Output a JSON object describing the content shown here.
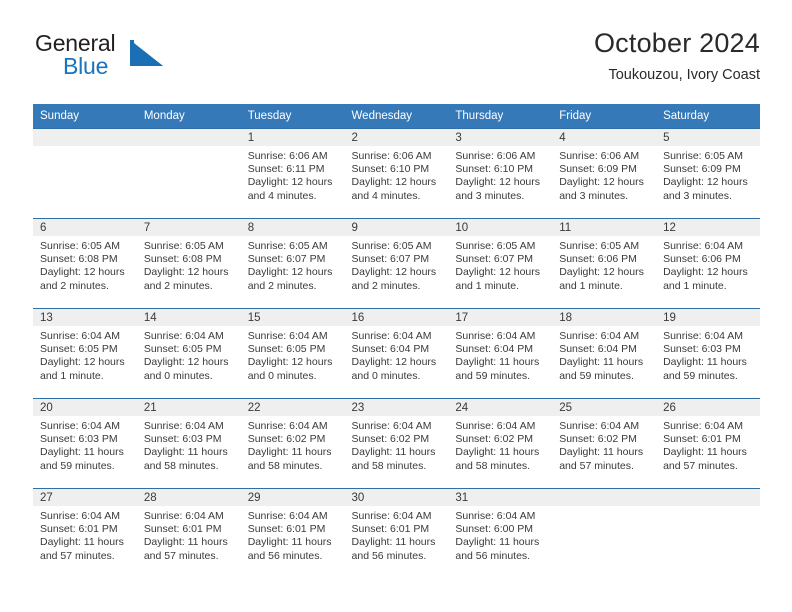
{
  "brand": {
    "word1": "General",
    "word2": "Blue",
    "mark_color": "#1a6fb5",
    "text_color": "#231f20",
    "blue_color": "#1a73c0"
  },
  "header": {
    "title": "October 2024",
    "subtitle": "Toukouzou, Ivory Coast"
  },
  "theme": {
    "header_blue": "#3579b8",
    "row_border": "#2f6fa8",
    "daynum_band": "#efefef",
    "text": "#3a3a3a"
  },
  "weekday_headers": [
    "Sunday",
    "Monday",
    "Tuesday",
    "Wednesday",
    "Thursday",
    "Friday",
    "Saturday"
  ],
  "weeks": [
    [
      {
        "day": "",
        "sunrise": "",
        "sunset": "",
        "daylight1": "",
        "daylight2": "",
        "empty": true
      },
      {
        "day": "",
        "sunrise": "",
        "sunset": "",
        "daylight1": "",
        "daylight2": "",
        "empty": true
      },
      {
        "day": "1",
        "sunrise": "Sunrise: 6:06 AM",
        "sunset": "Sunset: 6:11 PM",
        "daylight1": "Daylight: 12 hours",
        "daylight2": "and 4 minutes."
      },
      {
        "day": "2",
        "sunrise": "Sunrise: 6:06 AM",
        "sunset": "Sunset: 6:10 PM",
        "daylight1": "Daylight: 12 hours",
        "daylight2": "and 4 minutes."
      },
      {
        "day": "3",
        "sunrise": "Sunrise: 6:06 AM",
        "sunset": "Sunset: 6:10 PM",
        "daylight1": "Daylight: 12 hours",
        "daylight2": "and 3 minutes."
      },
      {
        "day": "4",
        "sunrise": "Sunrise: 6:06 AM",
        "sunset": "Sunset: 6:09 PM",
        "daylight1": "Daylight: 12 hours",
        "daylight2": "and 3 minutes."
      },
      {
        "day": "5",
        "sunrise": "Sunrise: 6:05 AM",
        "sunset": "Sunset: 6:09 PM",
        "daylight1": "Daylight: 12 hours",
        "daylight2": "and 3 minutes."
      }
    ],
    [
      {
        "day": "6",
        "sunrise": "Sunrise: 6:05 AM",
        "sunset": "Sunset: 6:08 PM",
        "daylight1": "Daylight: 12 hours",
        "daylight2": "and 2 minutes."
      },
      {
        "day": "7",
        "sunrise": "Sunrise: 6:05 AM",
        "sunset": "Sunset: 6:08 PM",
        "daylight1": "Daylight: 12 hours",
        "daylight2": "and 2 minutes."
      },
      {
        "day": "8",
        "sunrise": "Sunrise: 6:05 AM",
        "sunset": "Sunset: 6:07 PM",
        "daylight1": "Daylight: 12 hours",
        "daylight2": "and 2 minutes."
      },
      {
        "day": "9",
        "sunrise": "Sunrise: 6:05 AM",
        "sunset": "Sunset: 6:07 PM",
        "daylight1": "Daylight: 12 hours",
        "daylight2": "and 2 minutes."
      },
      {
        "day": "10",
        "sunrise": "Sunrise: 6:05 AM",
        "sunset": "Sunset: 6:07 PM",
        "daylight1": "Daylight: 12 hours",
        "daylight2": "and 1 minute."
      },
      {
        "day": "11",
        "sunrise": "Sunrise: 6:05 AM",
        "sunset": "Sunset: 6:06 PM",
        "daylight1": "Daylight: 12 hours",
        "daylight2": "and 1 minute."
      },
      {
        "day": "12",
        "sunrise": "Sunrise: 6:04 AM",
        "sunset": "Sunset: 6:06 PM",
        "daylight1": "Daylight: 12 hours",
        "daylight2": "and 1 minute."
      }
    ],
    [
      {
        "day": "13",
        "sunrise": "Sunrise: 6:04 AM",
        "sunset": "Sunset: 6:05 PM",
        "daylight1": "Daylight: 12 hours",
        "daylight2": "and 1 minute."
      },
      {
        "day": "14",
        "sunrise": "Sunrise: 6:04 AM",
        "sunset": "Sunset: 6:05 PM",
        "daylight1": "Daylight: 12 hours",
        "daylight2": "and 0 minutes."
      },
      {
        "day": "15",
        "sunrise": "Sunrise: 6:04 AM",
        "sunset": "Sunset: 6:05 PM",
        "daylight1": "Daylight: 12 hours",
        "daylight2": "and 0 minutes."
      },
      {
        "day": "16",
        "sunrise": "Sunrise: 6:04 AM",
        "sunset": "Sunset: 6:04 PM",
        "daylight1": "Daylight: 12 hours",
        "daylight2": "and 0 minutes."
      },
      {
        "day": "17",
        "sunrise": "Sunrise: 6:04 AM",
        "sunset": "Sunset: 6:04 PM",
        "daylight1": "Daylight: 11 hours",
        "daylight2": "and 59 minutes."
      },
      {
        "day": "18",
        "sunrise": "Sunrise: 6:04 AM",
        "sunset": "Sunset: 6:04 PM",
        "daylight1": "Daylight: 11 hours",
        "daylight2": "and 59 minutes."
      },
      {
        "day": "19",
        "sunrise": "Sunrise: 6:04 AM",
        "sunset": "Sunset: 6:03 PM",
        "daylight1": "Daylight: 11 hours",
        "daylight2": "and 59 minutes."
      }
    ],
    [
      {
        "day": "20",
        "sunrise": "Sunrise: 6:04 AM",
        "sunset": "Sunset: 6:03 PM",
        "daylight1": "Daylight: 11 hours",
        "daylight2": "and 59 minutes."
      },
      {
        "day": "21",
        "sunrise": "Sunrise: 6:04 AM",
        "sunset": "Sunset: 6:03 PM",
        "daylight1": "Daylight: 11 hours",
        "daylight2": "and 58 minutes."
      },
      {
        "day": "22",
        "sunrise": "Sunrise: 6:04 AM",
        "sunset": "Sunset: 6:02 PM",
        "daylight1": "Daylight: 11 hours",
        "daylight2": "and 58 minutes."
      },
      {
        "day": "23",
        "sunrise": "Sunrise: 6:04 AM",
        "sunset": "Sunset: 6:02 PM",
        "daylight1": "Daylight: 11 hours",
        "daylight2": "and 58 minutes."
      },
      {
        "day": "24",
        "sunrise": "Sunrise: 6:04 AM",
        "sunset": "Sunset: 6:02 PM",
        "daylight1": "Daylight: 11 hours",
        "daylight2": "and 58 minutes."
      },
      {
        "day": "25",
        "sunrise": "Sunrise: 6:04 AM",
        "sunset": "Sunset: 6:02 PM",
        "daylight1": "Daylight: 11 hours",
        "daylight2": "and 57 minutes."
      },
      {
        "day": "26",
        "sunrise": "Sunrise: 6:04 AM",
        "sunset": "Sunset: 6:01 PM",
        "daylight1": "Daylight: 11 hours",
        "daylight2": "and 57 minutes."
      }
    ],
    [
      {
        "day": "27",
        "sunrise": "Sunrise: 6:04 AM",
        "sunset": "Sunset: 6:01 PM",
        "daylight1": "Daylight: 11 hours",
        "daylight2": "and 57 minutes."
      },
      {
        "day": "28",
        "sunrise": "Sunrise: 6:04 AM",
        "sunset": "Sunset: 6:01 PM",
        "daylight1": "Daylight: 11 hours",
        "daylight2": "and 57 minutes."
      },
      {
        "day": "29",
        "sunrise": "Sunrise: 6:04 AM",
        "sunset": "Sunset: 6:01 PM",
        "daylight1": "Daylight: 11 hours",
        "daylight2": "and 56 minutes."
      },
      {
        "day": "30",
        "sunrise": "Sunrise: 6:04 AM",
        "sunset": "Sunset: 6:01 PM",
        "daylight1": "Daylight: 11 hours",
        "daylight2": "and 56 minutes."
      },
      {
        "day": "31",
        "sunrise": "Sunrise: 6:04 AM",
        "sunset": "Sunset: 6:00 PM",
        "daylight1": "Daylight: 11 hours",
        "daylight2": "and 56 minutes."
      },
      {
        "day": "",
        "sunrise": "",
        "sunset": "",
        "daylight1": "",
        "daylight2": "",
        "empty": true
      },
      {
        "day": "",
        "sunrise": "",
        "sunset": "",
        "daylight1": "",
        "daylight2": "",
        "empty": true
      }
    ]
  ]
}
